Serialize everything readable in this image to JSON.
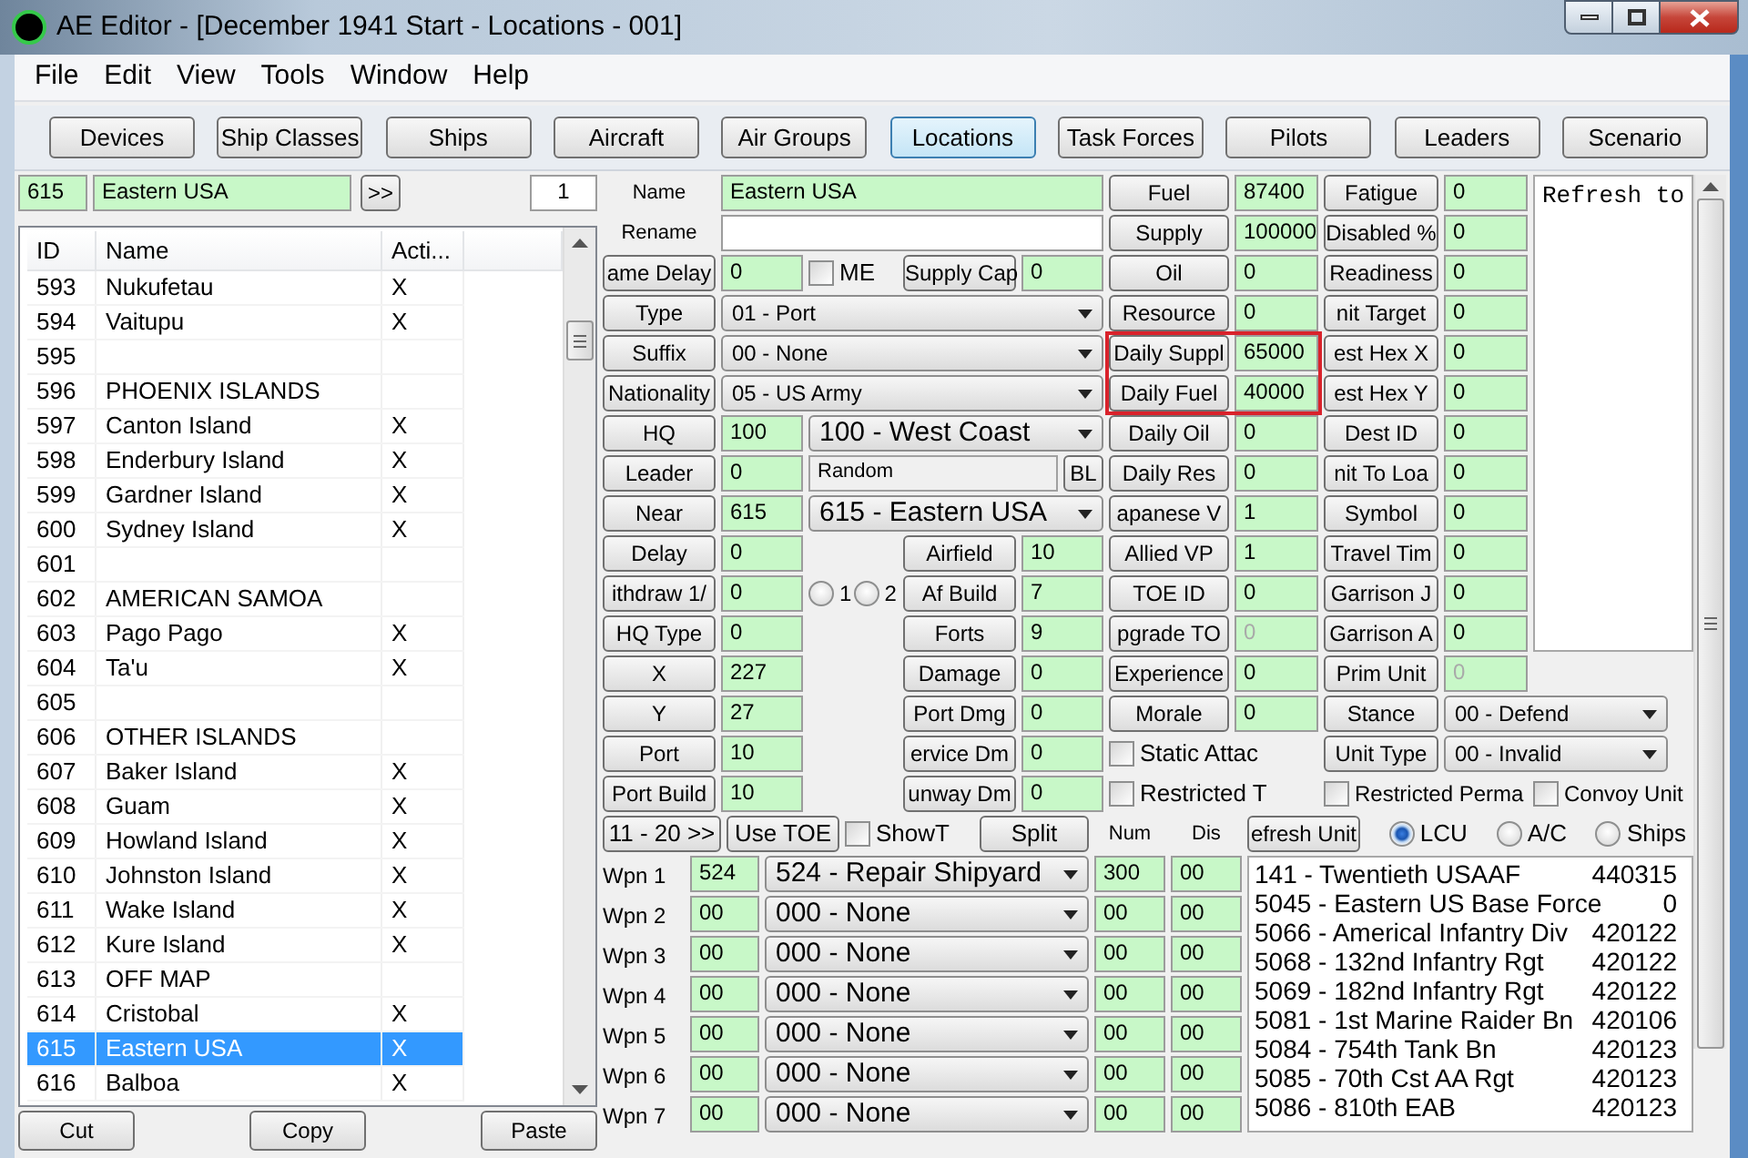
{
  "window": {
    "title": "AE Editor - [December 1941 Start - Locations - 001]"
  },
  "menu": [
    "File",
    "Edit",
    "View",
    "Tools",
    "Window",
    "Help"
  ],
  "toolbar": [
    {
      "label": "Devices",
      "selected": false
    },
    {
      "label": "Ship Classes",
      "selected": false
    },
    {
      "label": "Ships",
      "selected": false
    },
    {
      "label": "Aircraft",
      "selected": false
    },
    {
      "label": "Air Groups",
      "selected": false
    },
    {
      "label": "Locations",
      "selected": true
    },
    {
      "label": "Task Forces",
      "selected": false
    },
    {
      "label": "Pilots",
      "selected": false
    },
    {
      "label": "Leaders",
      "selected": false
    },
    {
      "label": "Scenario",
      "selected": false
    }
  ],
  "locator": {
    "id": "615",
    "name": "Eastern USA",
    "button": ">>",
    "count": "1"
  },
  "locations": {
    "columns": [
      "ID",
      "Name",
      "Acti..."
    ],
    "rows": [
      {
        "id": "593",
        "name": "Nukufetau",
        "active": "X",
        "selected": false
      },
      {
        "id": "594",
        "name": "Vaitupu",
        "active": "X",
        "selected": false
      },
      {
        "id": "595",
        "selected": false
      },
      {
        "id": "596",
        "name": "PHOENIX ISLANDS",
        "selected": false
      },
      {
        "id": "597",
        "name": "Canton Island",
        "active": "X",
        "selected": false
      },
      {
        "id": "598",
        "name": "Enderbury Island",
        "active": "X",
        "selected": false
      },
      {
        "id": "599",
        "name": "Gardner Island",
        "active": "X",
        "selected": false
      },
      {
        "id": "600",
        "name": "Sydney Island",
        "active": "X",
        "selected": false
      },
      {
        "id": "601",
        "selected": false
      },
      {
        "id": "602",
        "name": "AMERICAN SAMOA",
        "selected": false
      },
      {
        "id": "603",
        "name": "Pago Pago",
        "active": "X",
        "selected": false
      },
      {
        "id": "604",
        "name": "Ta'u",
        "active": "X",
        "selected": false
      },
      {
        "id": "605",
        "selected": false
      },
      {
        "id": "606",
        "name": "OTHER ISLANDS",
        "selected": false
      },
      {
        "id": "607",
        "name": "Baker Island",
        "active": "X",
        "selected": false
      },
      {
        "id": "608",
        "name": "Guam",
        "active": "X",
        "selected": false
      },
      {
        "id": "609",
        "name": "Howland Island",
        "active": "X",
        "selected": false
      },
      {
        "id": "610",
        "name": "Johnston Island",
        "active": "X",
        "selected": false
      },
      {
        "id": "611",
        "name": "Wake Island",
        "active": "X",
        "selected": false
      },
      {
        "id": "612",
        "name": "Kure Island",
        "active": "X",
        "selected": false
      },
      {
        "id": "613",
        "name": "OFF MAP",
        "selected": false
      },
      {
        "id": "614",
        "name": "Cristobal",
        "active": "X",
        "selected": false
      },
      {
        "id": "615",
        "name": "Eastern USA",
        "active": "X",
        "selected": true
      },
      {
        "id": "616",
        "name": "Balboa",
        "active": "X",
        "selected": false
      }
    ],
    "buttons": [
      "Cut",
      "Copy",
      "Paste"
    ]
  },
  "record": {
    "name": {
      "label": "Name",
      "value": "Eastern USA"
    },
    "rename": {
      "label": "Rename"
    }
  },
  "general": [
    {
      "kind": "field",
      "label": "ame Delay",
      "value": "0"
    },
    {
      "kind": "select",
      "label": "Type",
      "value": "01 - Port"
    },
    {
      "kind": "select",
      "label": "Suffix",
      "value": "00 - None"
    },
    {
      "kind": "select",
      "label": "Nationality",
      "value": "05 - US Army"
    },
    {
      "kind": "field_select",
      "label": "HQ",
      "value": "100",
      "option": "100 - West Coast"
    },
    {
      "kind": "field_text",
      "label": "Leader",
      "value": "0",
      "text": "Random",
      "button": "BL"
    },
    {
      "kind": "field_select",
      "label": "Near",
      "value": "615",
      "option": "615 - Eastern USA"
    },
    {
      "kind": "field",
      "label": "Delay",
      "value": "0"
    },
    {
      "kind": "field",
      "label": "ithdraw 1/",
      "value": "0"
    },
    {
      "kind": "field",
      "label": "HQ Type",
      "value": "0"
    },
    {
      "kind": "field",
      "label": "X",
      "value": "227"
    },
    {
      "kind": "field",
      "label": "Y",
      "value": "27"
    },
    {
      "kind": "field",
      "label": "Port",
      "value": "10"
    },
    {
      "kind": "field",
      "label": "Port Build",
      "value": "10"
    }
  ],
  "me_checkbox": {
    "label": "ME",
    "checked": false
  },
  "supply_cap": {
    "label": "Supply Cap",
    "value": "0"
  },
  "withdraw_choice": [
    {
      "label": "1",
      "selected": false
    },
    {
      "label": "2",
      "selected": false
    }
  ],
  "facilities": [
    {
      "label": "Airfield",
      "value": "10"
    },
    {
      "label": "Af Build",
      "value": "7"
    },
    {
      "label": "Forts",
      "value": "9"
    },
    {
      "label": "Damage",
      "value": "0"
    },
    {
      "label": "Port Dmg",
      "value": "0"
    },
    {
      "label": "ervice Dm",
      "value": "0"
    },
    {
      "label": "unway Dm",
      "value": "0"
    }
  ],
  "stocks": [
    {
      "label": "Fuel",
      "value": "87400",
      "disabled": false,
      "highlighted": false
    },
    {
      "label": "Supply",
      "value": "100000",
      "disabled": false,
      "highlighted": false
    },
    {
      "label": "Oil",
      "value": "0",
      "disabled": false,
      "highlighted": false
    },
    {
      "label": "Resource",
      "value": "0",
      "disabled": false,
      "highlighted": false
    },
    {
      "label": "Daily Suppl",
      "value": "65000",
      "disabled": false,
      "highlighted": true
    },
    {
      "label": "Daily Fuel",
      "value": "40000",
      "disabled": false,
      "highlighted": true
    },
    {
      "label": "Daily Oil",
      "value": "0",
      "disabled": false,
      "highlighted": false
    },
    {
      "label": "Daily Res",
      "value": "0",
      "disabled": false,
      "highlighted": false
    },
    {
      "label": "apanese V",
      "value": "1",
      "disabled": false,
      "highlighted": false
    },
    {
      "label": "Allied VP",
      "value": "1",
      "disabled": false,
      "highlighted": false
    },
    {
      "label": "TOE ID",
      "value": "0",
      "disabled": false,
      "highlighted": false
    },
    {
      "label": "pgrade TO",
      "value": "0",
      "disabled": true,
      "highlighted": false
    },
    {
      "label": "Experience",
      "value": "0",
      "disabled": false,
      "highlighted": false
    },
    {
      "label": "Morale",
      "value": "0",
      "disabled": false,
      "highlighted": false
    }
  ],
  "stock_flags": [
    {
      "label": "Static Attac",
      "checked": false
    },
    {
      "label": "Restricted T",
      "checked": false
    }
  ],
  "status": [
    {
      "label": "Fatigue",
      "value": "0",
      "disabled": false
    },
    {
      "label": "Disabled %",
      "value": "0",
      "disabled": false
    },
    {
      "label": "Readiness",
      "value": "0",
      "disabled": false
    },
    {
      "label": "nit Target",
      "value": "0",
      "disabled": false
    },
    {
      "label": "est Hex X",
      "value": "0",
      "disabled": false
    },
    {
      "label": "est Hex Y",
      "value": "0",
      "disabled": false
    },
    {
      "label": "Dest ID",
      "value": "0",
      "disabled": false
    },
    {
      "label": "nit To Loa",
      "value": "0",
      "disabled": false
    },
    {
      "label": "Symbol",
      "value": "0",
      "disabled": false
    },
    {
      "label": "Travel Tim",
      "value": "0",
      "disabled": false
    },
    {
      "label": "Garrison J",
      "value": "0",
      "disabled": false
    },
    {
      "label": "Garrison A",
      "value": "0",
      "disabled": false
    },
    {
      "label": "Prim Unit",
      "value": "0",
      "disabled": true
    }
  ],
  "status_selects": [
    {
      "label": "Stance",
      "value": "00 - Defend"
    },
    {
      "label": "Unit Type",
      "value": "00 - Invalid"
    }
  ],
  "unit_flags": [
    {
      "label": "Restricted Perma",
      "checked": false
    },
    {
      "label": "Convoy Unit",
      "checked": false
    }
  ],
  "notes": {
    "text": "Refresh to"
  },
  "weapons": {
    "page_button": "11 - 20 >>",
    "toe_button": "Use TOE",
    "show_toe": {
      "label": "ShowT",
      "checked": false
    },
    "split_button": "Split",
    "columns": [
      "Num",
      "Dis"
    ],
    "rows": [
      {
        "label": "Wpn 1",
        "id": "524",
        "device": "524 - Repair Shipyard",
        "num": "300",
        "dis": "00"
      },
      {
        "label": "Wpn 2",
        "id": "00",
        "device": "000 - None",
        "num": "00",
        "dis": "00"
      },
      {
        "label": "Wpn 3",
        "id": "00",
        "device": "000 - None",
        "num": "00",
        "dis": "00"
      },
      {
        "label": "Wpn 4",
        "id": "00",
        "device": "000 - None",
        "num": "00",
        "dis": "00"
      },
      {
        "label": "Wpn 5",
        "id": "00",
        "device": "000 - None",
        "num": "00",
        "dis": "00"
      },
      {
        "label": "Wpn 6",
        "id": "00",
        "device": "000 - None",
        "num": "00",
        "dis": "00"
      },
      {
        "label": "Wpn 7",
        "id": "00",
        "device": "000 - None",
        "num": "00",
        "dis": "00"
      }
    ]
  },
  "units": {
    "refresh_button": "efresh Unit",
    "filters": [
      {
        "label": "LCU",
        "selected": true
      },
      {
        "label": "A/C",
        "selected": false
      },
      {
        "label": "Ships",
        "selected": false
      }
    ],
    "items": [
      {
        "name": "141 - Twentieth USAAF",
        "value": "440315"
      },
      {
        "name": "5045 - Eastern US Base Force",
        "value": "0"
      },
      {
        "name": "5066 - Americal Infantry Div",
        "value": "420122"
      },
      {
        "name": "5068 - 132nd Infantry Rgt",
        "value": "420122"
      },
      {
        "name": "5069 - 182nd Infantry Rgt",
        "value": "420122"
      },
      {
        "name": "5081 - 1st Marine Raider Bn",
        "value": "420106"
      },
      {
        "name": "5084 - 754th Tank Bn",
        "value": "420123"
      },
      {
        "name": "5085 - 70th Cst AA Rgt",
        "value": "420123"
      },
      {
        "name": "5086 - 810th EAB",
        "value": "420123"
      }
    ]
  }
}
